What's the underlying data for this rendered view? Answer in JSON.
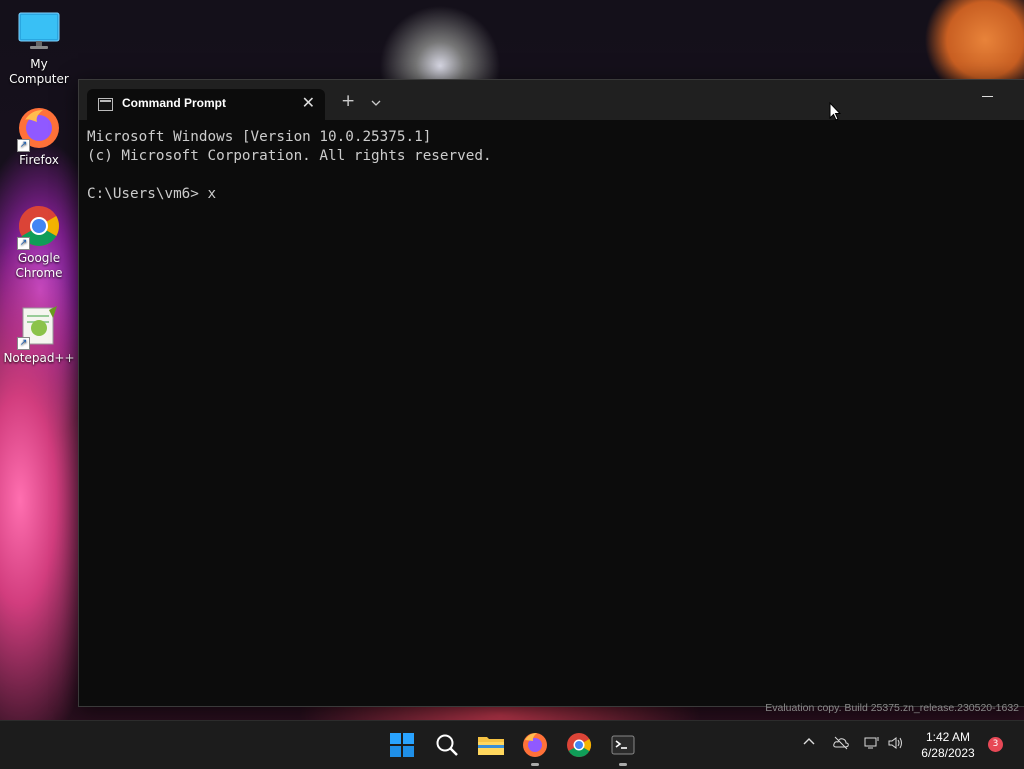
{
  "desktop": {
    "icons": [
      {
        "label": "My Computer"
      },
      {
        "label": "Firefox"
      },
      {
        "label": "Google Chrome"
      },
      {
        "label": "Notepad++"
      }
    ]
  },
  "terminal": {
    "tab_title": "Command Prompt",
    "tab_close": "✕",
    "new_tab": "+",
    "lines": [
      "Microsoft Windows [Version 10.0.25375.1]",
      "(c) Microsoft Corporation. All rights reserved.",
      "",
      "C:\\Users\\vm6> x"
    ]
  },
  "watermark": "Evaluation copy. Build 25375.zn_release.230520-1632",
  "taskbar": {
    "apps": [
      "start-icon",
      "search-icon",
      "file-explorer-icon",
      "firefox-icon",
      "chrome-icon",
      "terminal-icon"
    ],
    "clock_time": "1:42 AM",
    "clock_date": "6/28/2023",
    "notification_count": "3"
  },
  "colors": {
    "terminal_bg": "#0c0c0c",
    "titlebar_bg": "#202020",
    "taskbar_bg": "#1c1c1c",
    "text": "#cccccc",
    "accent": "#0078d4"
  }
}
